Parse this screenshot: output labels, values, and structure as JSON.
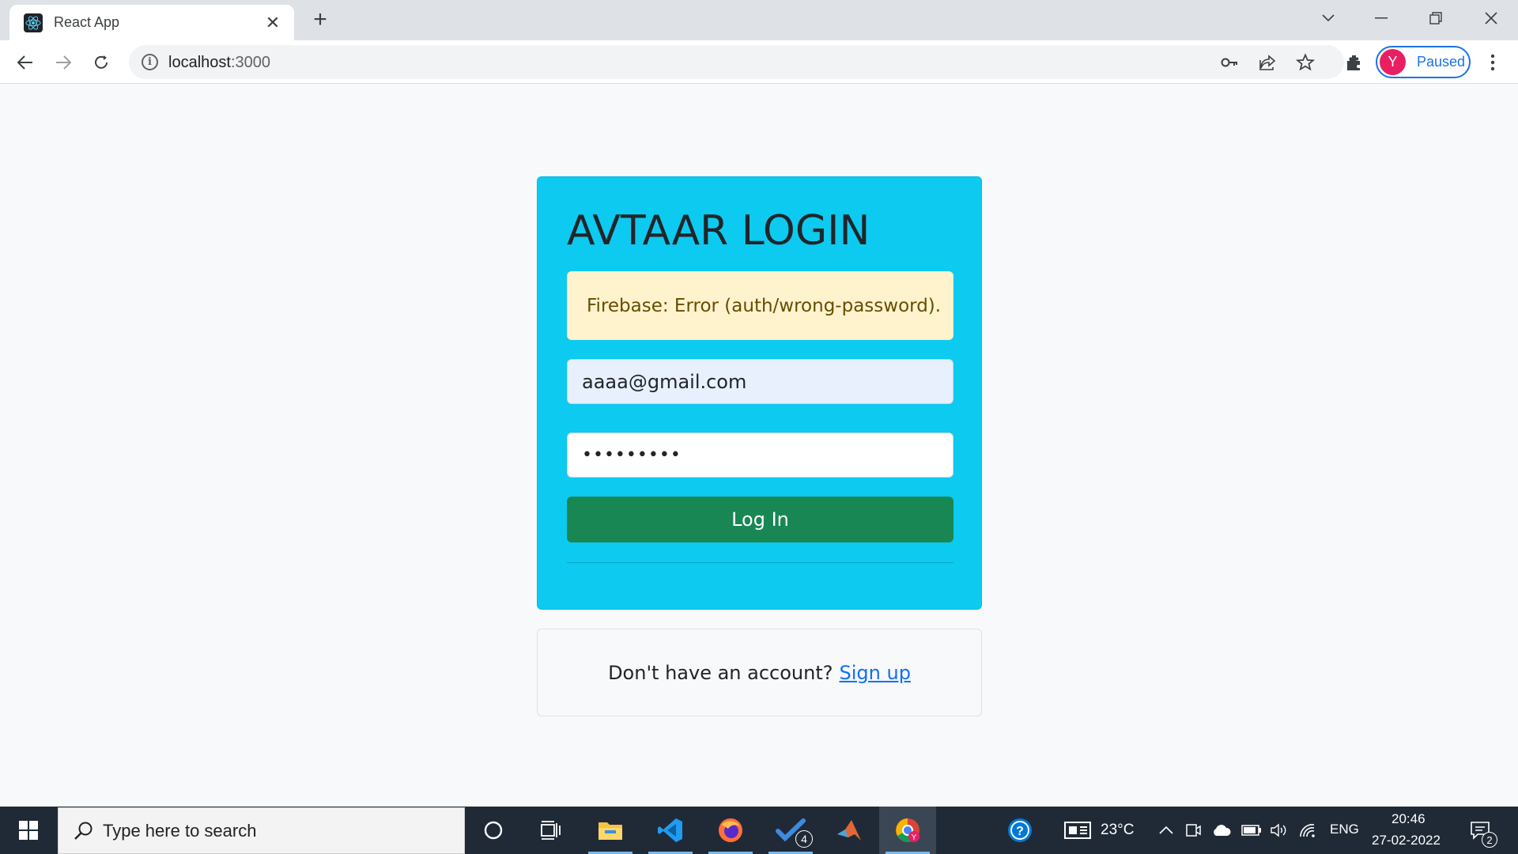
{
  "browser": {
    "tab_title": "React App",
    "tab_close": "✕",
    "new_tab": "+",
    "url_host": "localhost",
    "url_port": ":3000",
    "profile_initial": "Y",
    "profile_status": "Paused",
    "window_controls": {
      "tab_search": "⌄",
      "minimize": "—",
      "restore": "❐",
      "close": "✕"
    }
  },
  "login": {
    "title": "AVTAAR LOGIN",
    "error_message": "Firebase: Error (auth/wrong-password).",
    "email_value": "aaaa@gmail.com",
    "password_mask": "•••••••••",
    "login_button": "Log In"
  },
  "signup": {
    "prompt": "Don't have an account?",
    "link": "Sign up"
  },
  "taskbar": {
    "search_placeholder": "Type here to search",
    "todo_badge": "4",
    "temperature": "23°C",
    "language": "ENG",
    "time": "20:46",
    "date": "27-02-2022",
    "notification_count": "2"
  },
  "colors": {
    "card_bg": "#0dcaf0",
    "alert_bg": "#fff3cd",
    "button_bg": "#198754",
    "link": "#0d6efd",
    "taskbar_bg": "#202a37"
  }
}
